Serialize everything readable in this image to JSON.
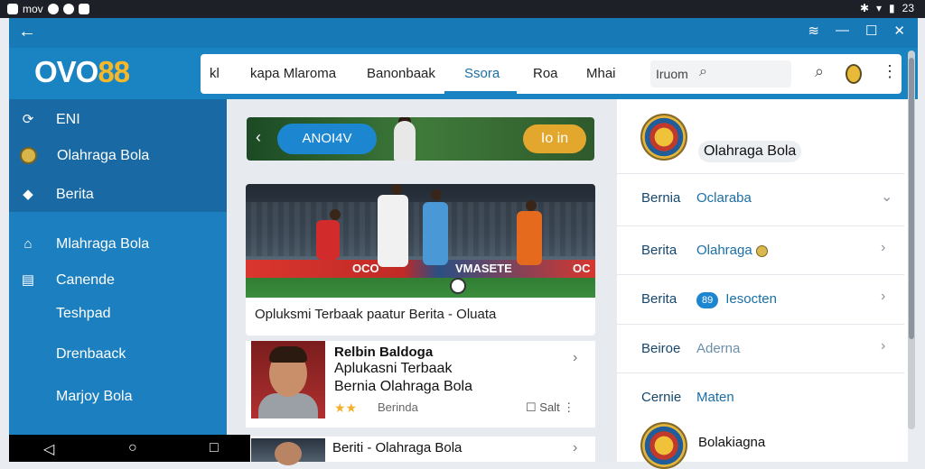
{
  "status_bar": {
    "left_text": "mov",
    "right_text": "23"
  },
  "header": {
    "logo_part1": "OVO",
    "logo_part2": "88",
    "nav": [
      "kl",
      "kapa Mlaroma",
      "Banonbaak",
      "Ssora",
      "Roa",
      "Mhai"
    ],
    "active_nav_index": 3,
    "search_text": "Iruom"
  },
  "sidebar": {
    "items": [
      "ENI",
      "Olahraga Bola",
      "Berita",
      "Mlahraga Bola",
      "Canende",
      "Teshpad",
      "Drenbaack",
      "Marjoy Bola"
    ]
  },
  "banner": {
    "left_label": "ANOI4V",
    "right_label": "Io in"
  },
  "featured": {
    "title": "Opluksmi Terbaak paatur Berita - Oluata",
    "ad_board": [
      "OCO",
      "VMASETE",
      "OC"
    ]
  },
  "list": {
    "item1": {
      "line1": "Relbin Baldoga",
      "line2": "Aplukasni Terbaak",
      "line3": "Bernia Olahraga Bola",
      "meta": "Berinda",
      "save_label": "Salt",
      "rating": "★★"
    },
    "item2": {
      "title": "Beriti - Olahraga Bola"
    }
  },
  "right_panel": {
    "header": "Olahraga Bola",
    "rows": [
      {
        "key": "Bernia",
        "value": "Oclaraba"
      },
      {
        "key": "Berita",
        "value": "Olahraga"
      },
      {
        "key": "Berita",
        "value": "Iesocten",
        "badge": "89"
      },
      {
        "key": "Beiroe",
        "value": "Aderna"
      },
      {
        "key": "Cernie",
        "value": "Maten"
      }
    ],
    "footer": "Bolakiagna"
  },
  "colors": {
    "accent": "#1a83c2",
    "dark_blue": "#1869a4",
    "gold": "#e3a72e"
  }
}
